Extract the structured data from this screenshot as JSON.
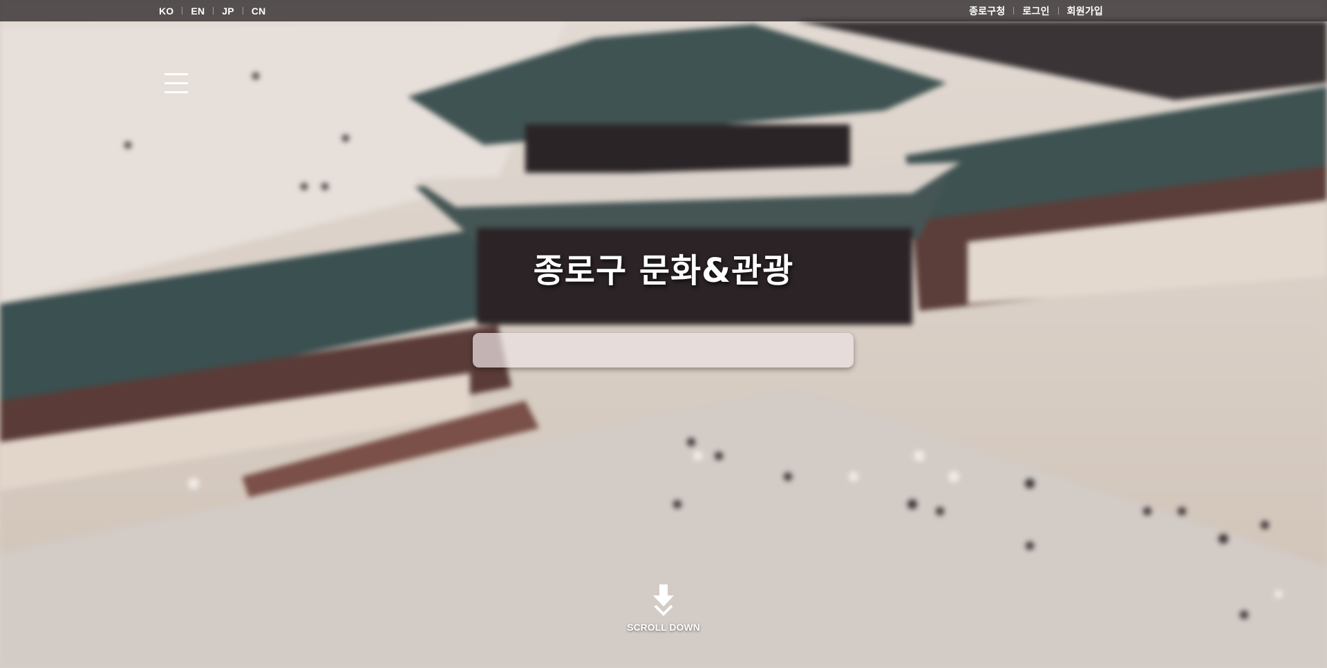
{
  "header": {
    "languages": [
      "KO",
      "EN",
      "JP",
      "CN"
    ],
    "util_links": [
      "종로구청",
      "로그인",
      "회원가입"
    ]
  },
  "hero": {
    "title": "종로구 문화&관광",
    "search": {
      "value": "",
      "placeholder": ""
    }
  },
  "scroll": {
    "label": "SCROLL DOWN"
  },
  "icons": {
    "menu": "hamburger-icon",
    "scroll": "arrow-down-icon"
  },
  "colors": {
    "topbar": "#2d282a",
    "text": "#ffffff",
    "search_bg": "#ece2e2"
  }
}
